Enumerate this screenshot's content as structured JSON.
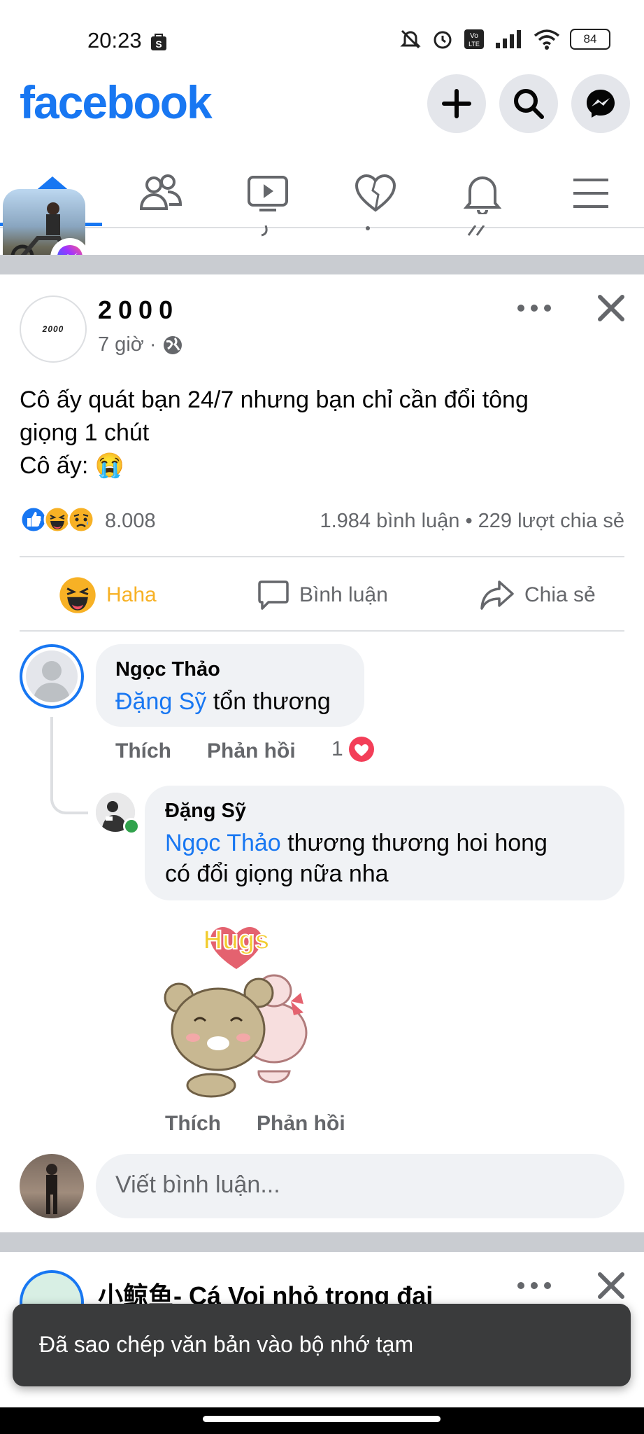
{
  "status_bar": {
    "time": "20:23",
    "battery": "84"
  },
  "header": {
    "logo": "facebook"
  },
  "nav": [
    "home-icon",
    "friends-icon",
    "watch-icon",
    "dating-icon",
    "notifications-icon",
    "menu-icon"
  ],
  "post": {
    "author": "2000",
    "avatar_text": "2000",
    "time": "7 giờ ·",
    "text_line1": "Cô ấy quát bạn 24/7 nhưng bạn chỉ cần đổi tông",
    "text_line2": "giọng 1 chút",
    "text_line3": "Cô ấy: 😭",
    "reaction_count": "8.008",
    "stats": "1.984 bình luận • 229 lượt chia sẻ",
    "actions": {
      "react": "Haha",
      "comment": "Bình luận",
      "share": "Chia sẻ"
    }
  },
  "comments": [
    {
      "name": "Ngọc Thảo",
      "mention": "Đặng Sỹ",
      "text": " tổn thương",
      "like": "Thích",
      "reply": "Phản hồi",
      "reaction_count": "1"
    },
    {
      "name": "Đặng Sỹ",
      "mention": "Ngọc Thảo",
      "text_line1": " thương thương hoi hong",
      "text_line2": "có đổi giọng nữa nha",
      "sticker_text": "Hugs",
      "like": "Thích",
      "reply": "Phản hồi"
    }
  ],
  "write_comment": {
    "placeholder": "Viết bình luận..."
  },
  "next_post": {
    "author": "小鲸鱼- Cá Voi nhỏ trong đại"
  },
  "toast": {
    "text": "Đã sao chép văn bản vào bộ nhớ tạm"
  },
  "colors": {
    "brand": "#1877f2",
    "haha": "#f7b125",
    "secondary_text": "#65676b"
  }
}
